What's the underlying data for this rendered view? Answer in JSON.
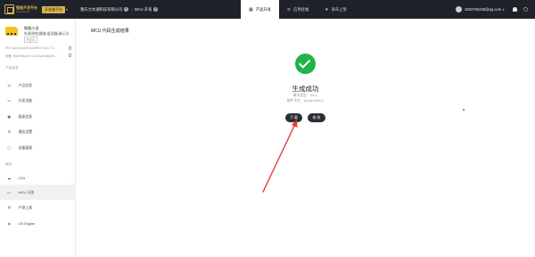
{
  "topbar": {
    "logo_line1": "智能开发平台",
    "logo_line2": "Tuya Smart",
    "platform_badge": "开发者平台",
    "platform_caret": "▾",
    "company": "重庆大木通科技有限公司",
    "crumb": "MCU 开发",
    "account": "3363793438@qq.com",
    "account_caret": "▾"
  },
  "nav_tabs": [
    {
      "label": "产品开发",
      "icon": "grid-icon",
      "active": true
    },
    {
      "label": "应用抚幅",
      "icon": "wifi-icon",
      "active": false
    },
    {
      "label": "发布上架",
      "icon": "send-icon",
      "active": false
    }
  ],
  "product": {
    "name": "智能小台",
    "desc": "处理测控(播放/监测器)演示文...",
    "tag": "开发中",
    "pid": "PID: fa4vLtbozM1hd2M9x07bpo1 7c...",
    "device": "设备: 9b0eRbpd9Tv1c7bbpbe0lq00b..."
  },
  "sidebar": {
    "section1": "产品信息",
    "items1": [
      {
        "label": "产品信息",
        "icon": "info-icon"
      },
      {
        "label": "开发功能",
        "icon": "code-icon"
      },
      {
        "label": "面板信息",
        "icon": "panel-icon"
      },
      {
        "label": "通信设置",
        "icon": "gear-icon"
      },
      {
        "label": "设备管理",
        "icon": "device-icon"
      }
    ],
    "section2": "服务",
    "items2": [
      {
        "label": "OTA",
        "icon": "cloud-icon"
      },
      {
        "label": "MCU 开发",
        "icon": "code-brackets-icon"
      },
      {
        "label": "产测工具",
        "icon": "wrench-icon"
      },
      {
        "label": "OS Engine",
        "icon": "engine-icon"
      }
    ]
  },
  "main": {
    "title": "MCU 代码生成结果",
    "result_title": "生成成功",
    "meta1": "模块类型：MCU",
    "meta2": "硬件平台：Arduino/MCU",
    "download_label": "下 载",
    "modify_label": "修 改"
  },
  "colors": {
    "topbar": "#1f2329",
    "success": "#21b24b",
    "button": "#2b2f36",
    "accent_gold": "#d8b34a",
    "annotation_arrow": "#e53935"
  }
}
